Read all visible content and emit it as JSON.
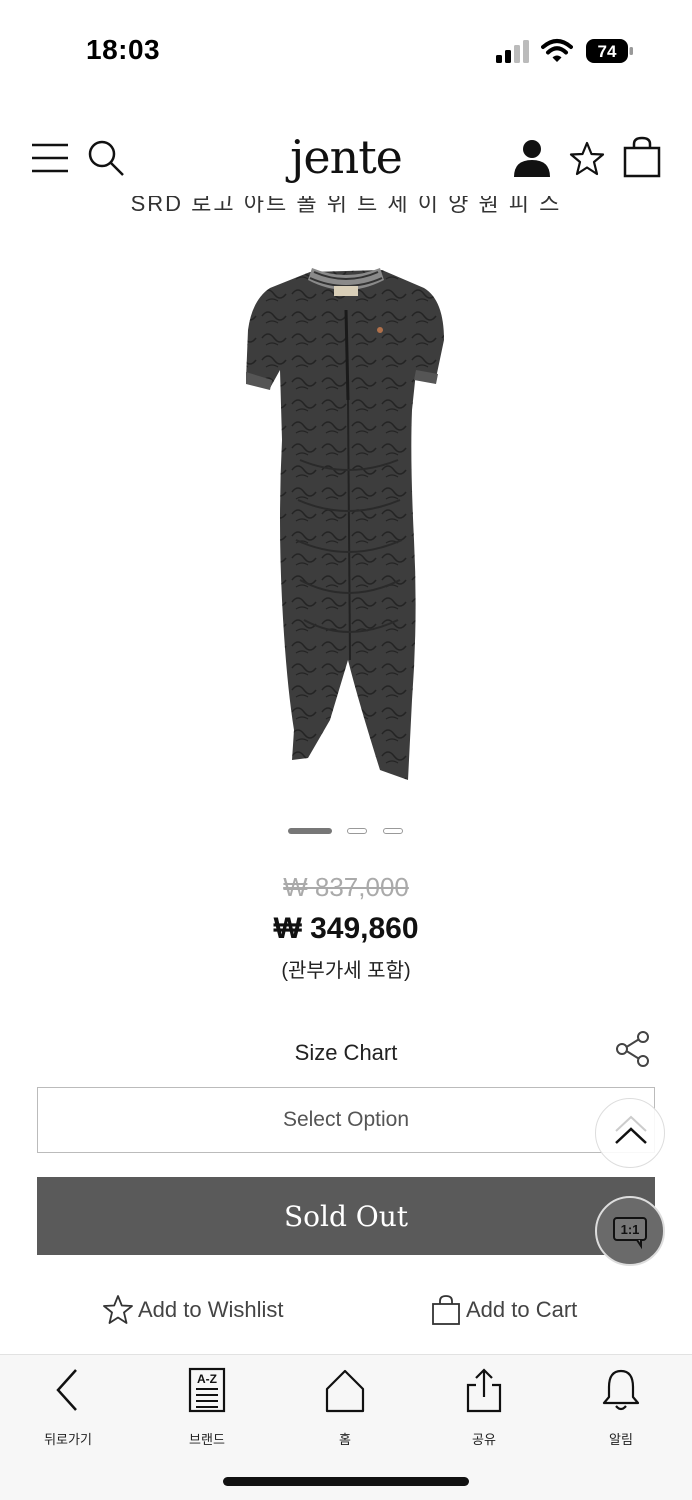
{
  "status_bar": {
    "time": "18:03",
    "battery": "74"
  },
  "header": {
    "logo": "jente",
    "title_peek": "SRD 로고 아트 폴 위 트 세 이 양 원 피 스"
  },
  "product": {
    "image_alt": "black ruched polo dress",
    "carousel": {
      "count": 3,
      "active": 0
    },
    "price_original": "₩ 837,000",
    "price_sale": "₩ 349,860",
    "price_note": "(관부가세 포함)"
  },
  "options": {
    "size_chart": "Size Chart",
    "select_placeholder": "Select Option",
    "sold_out_label": "Sold Out"
  },
  "actions": {
    "wishlist": "Add to Wishlist",
    "cart": "Add to Cart"
  },
  "floating": {
    "chat_label": "1:1"
  },
  "bottom_nav": {
    "items": [
      {
        "label": "뒤로가기",
        "icon": "back-chevron-icon"
      },
      {
        "label": "브랜드",
        "icon": "a-z-brand-icon"
      },
      {
        "label": "홈",
        "icon": "home-icon"
      },
      {
        "label": "공유",
        "icon": "share-upload-icon"
      },
      {
        "label": "알림",
        "icon": "bell-icon"
      }
    ]
  },
  "colors": {
    "sold_out_bg": "#5a5a5a",
    "text": "#222222",
    "nav_bg": "#f7f7f7"
  }
}
